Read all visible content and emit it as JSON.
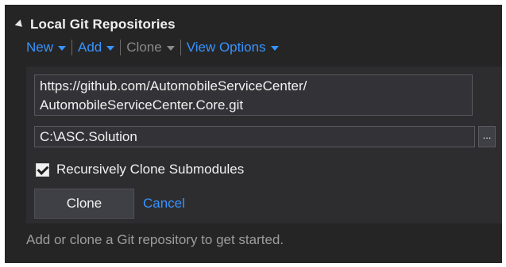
{
  "section": {
    "title": "Local Git Repositories"
  },
  "menu": {
    "new_label": "New",
    "add_label": "Add",
    "clone_label": "Clone",
    "view_options_label": "View Options"
  },
  "clone_form": {
    "url_line1": "https://github.com/AutomobileServiceCenter/",
    "url_line2": "AutomobileServiceCenter.Core.git",
    "path_value": "C:\\ASC.Solution",
    "browse_label": "...",
    "recursive_label": "Recursively Clone Submodules",
    "recursive_checked": true,
    "clone_button_label": "Clone",
    "cancel_label": "Cancel"
  },
  "hint": "Add or clone a Git repository to get started.",
  "colors": {
    "panel_bg": "#252526",
    "link": "#3794ff",
    "text": "#f1f1f1",
    "muted": "#9d9d9d"
  }
}
